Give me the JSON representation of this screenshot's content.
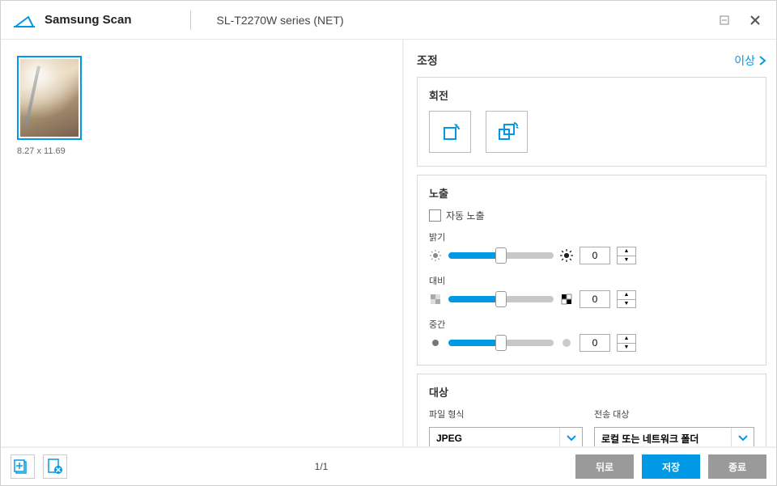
{
  "header": {
    "app_title": "Samsung Scan",
    "model": "SL-T2270W series (NET)"
  },
  "preview": {
    "dims": "8.27  x  11.69"
  },
  "panel": {
    "title": "조정",
    "more_label": "이상",
    "rotation": {
      "title": "회전"
    },
    "exposure": {
      "title": "노출",
      "auto_label": "자동 노출",
      "brightness": {
        "label": "밝기",
        "value": "0"
      },
      "contrast": {
        "label": "대비",
        "value": "0"
      },
      "midtone": {
        "label": "중간",
        "value": "0"
      }
    },
    "dest": {
      "title": "대상",
      "format_label": "파일 형식",
      "format_value": "JPEG",
      "target_label": "전송 대상",
      "target_value": "로컬 또는 네트워크 폴더"
    }
  },
  "footer": {
    "page": "1/1",
    "back": "뒤로",
    "save": "저장",
    "exit": "종료"
  }
}
